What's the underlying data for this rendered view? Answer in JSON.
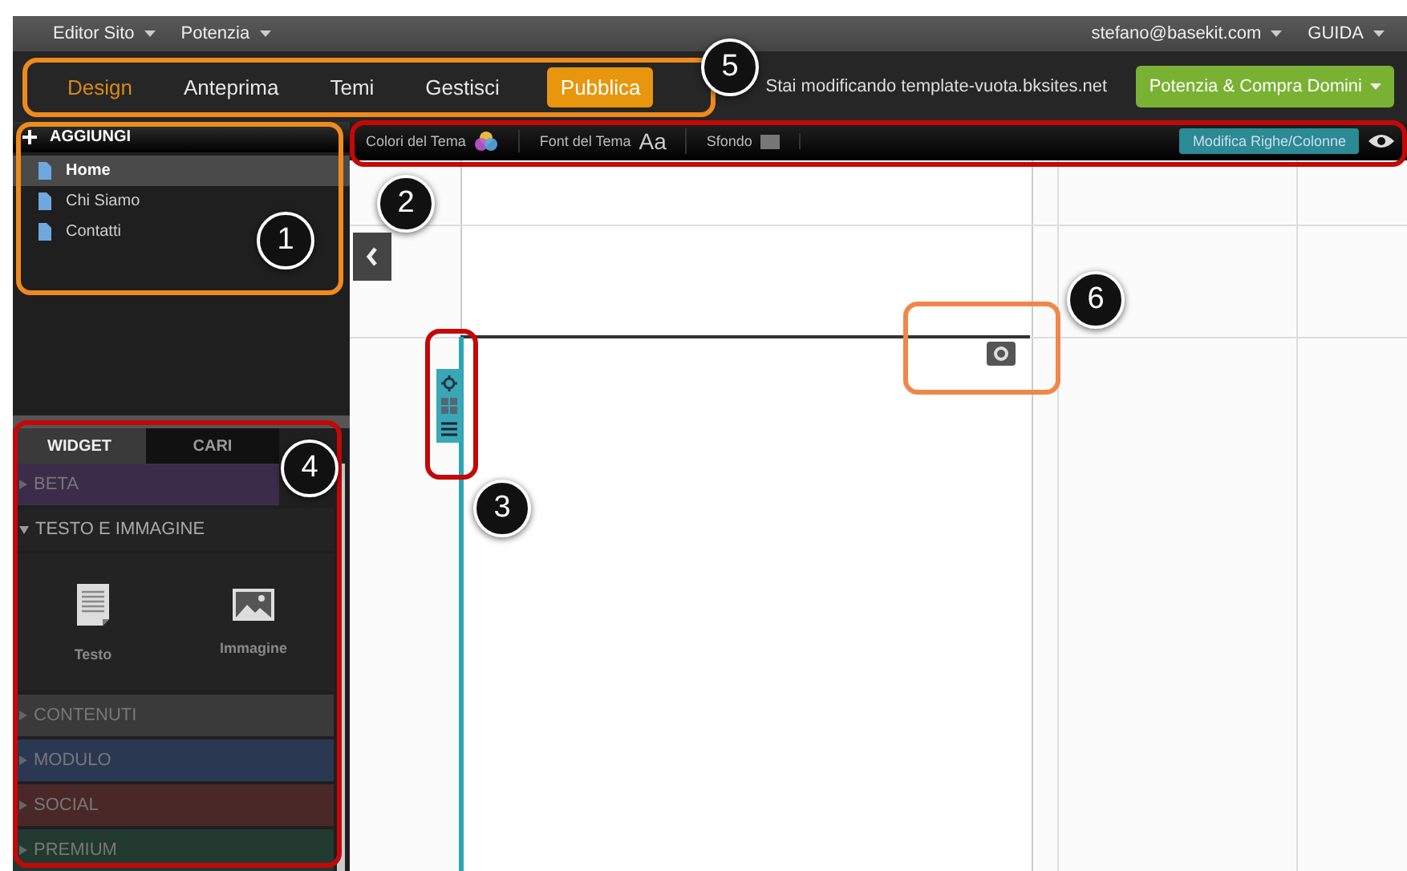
{
  "menu_bar": {
    "left": [
      {
        "label": "Editor Sito"
      },
      {
        "label": "Potenzia"
      }
    ],
    "right": [
      {
        "label": "stefano@basekit.com"
      },
      {
        "label": "GUIDA"
      }
    ]
  },
  "nav": {
    "tabs": [
      {
        "label": "Design",
        "selected": true
      },
      {
        "label": "Anteprima",
        "selected": false
      },
      {
        "label": "Temi",
        "selected": false
      },
      {
        "label": "Gestisci",
        "selected": false
      }
    ],
    "publish_button": "Pubblica",
    "editing_notice": "Stai modificando template-vuota.bksites.net",
    "upgrade_button": "Potenzia & Compra Domini"
  },
  "sidebar": {
    "add_header": "AGGIUNGI",
    "pages": [
      {
        "label": "Home",
        "selected": true
      },
      {
        "label": "Chi Siamo",
        "selected": false
      },
      {
        "label": "Contatti",
        "selected": false
      }
    ],
    "widget_tabs": [
      {
        "label": "WIDGET",
        "selected": true
      },
      {
        "label": "CARI",
        "selected": false
      }
    ],
    "categories": [
      {
        "label": "BETA",
        "color": "#3b2d4a",
        "expanded": false
      },
      {
        "label": "TESTO E IMMAGINE",
        "color": "#232323",
        "expanded": true,
        "widgets": [
          {
            "label": "Testo",
            "kind": "text"
          },
          {
            "label": "Immagine",
            "kind": "image"
          }
        ]
      },
      {
        "label": "CONTENUTI",
        "color": "#3a3a3a",
        "expanded": false
      },
      {
        "label": "MODULO",
        "color": "#2b3852",
        "expanded": false
      },
      {
        "label": "SOCIAL",
        "color": "#4a2828",
        "expanded": false
      },
      {
        "label": "PREMIUM",
        "color": "#22392f",
        "expanded": false
      }
    ]
  },
  "toolbar": {
    "items": [
      {
        "label": "Colori del Tema",
        "kind": "colors"
      },
      {
        "label": "Font del Tema",
        "kind": "font",
        "sample": "Aa"
      },
      {
        "label": "Sfondo",
        "kind": "background"
      }
    ],
    "layout_button": "Modifica Righe/Colonne"
  },
  "callouts": [
    {
      "number": "1",
      "color": "#f08a1c"
    },
    {
      "number": "2",
      "color": "#c40808"
    },
    {
      "number": "3",
      "color": "#c40808"
    },
    {
      "number": "4",
      "color": "#c40808"
    },
    {
      "number": "5",
      "color": "#f08a1c"
    },
    {
      "number": "6",
      "color": "#f0874a"
    }
  ]
}
